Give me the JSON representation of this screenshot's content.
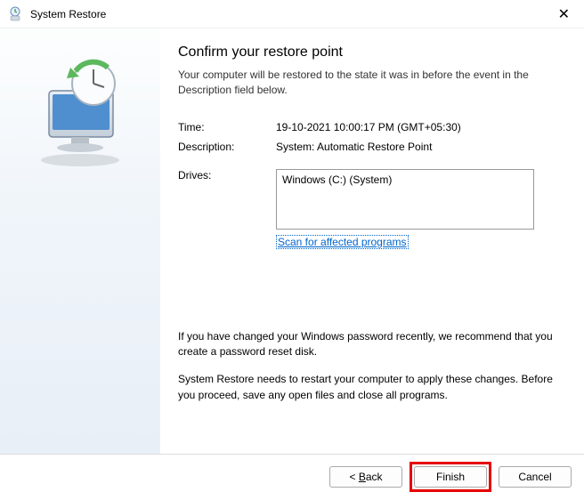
{
  "titlebar": {
    "title": "System Restore"
  },
  "main": {
    "heading": "Confirm your restore point",
    "subheading": "Your computer will be restored to the state it was in before the event in the Description field below.",
    "time_label": "Time:",
    "time_value": "19-10-2021 10:00:17 PM (GMT+05:30)",
    "desc_label": "Description:",
    "desc_value": "System: Automatic Restore Point",
    "drives_label": "Drives:",
    "drives_value": "Windows (C:) (System)",
    "scan_link": "Scan for affected programs",
    "info1": "If you have changed your Windows password recently, we recommend that you create a password reset disk.",
    "info2": "System Restore needs to restart your computer to apply these changes. Before you proceed, save any open files and close all programs."
  },
  "footer": {
    "back": "Back",
    "finish": "Finish",
    "cancel": "Cancel"
  }
}
